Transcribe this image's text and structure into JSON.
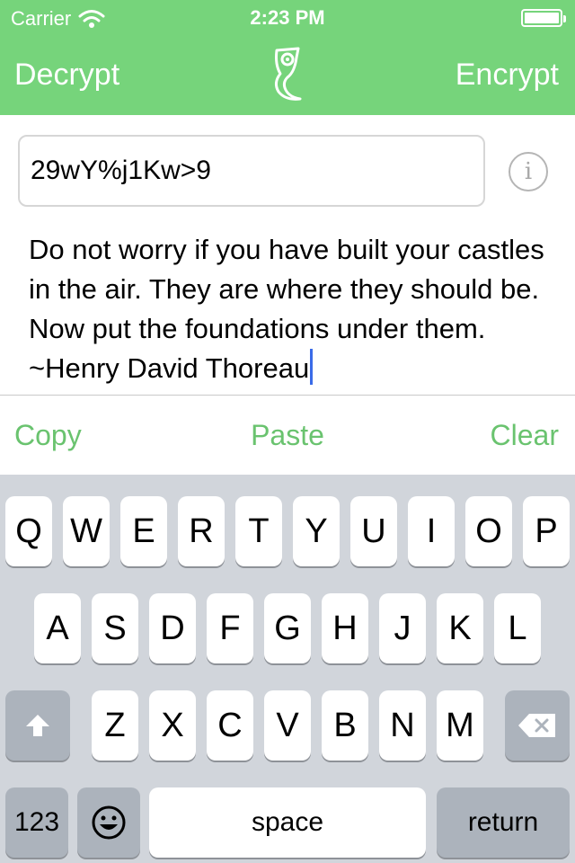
{
  "status_bar": {
    "carrier": "Carrier",
    "time": "2:23 PM"
  },
  "nav": {
    "left_label": "Decrypt",
    "right_label": "Encrypt",
    "logo_icon": "bird-logo-icon"
  },
  "key_field": {
    "value": "29wY%j1Kw>9"
  },
  "info_button": {
    "glyph": "i"
  },
  "message": {
    "text": "Do not worry if you have built your castles in the air. They are where they should be. Now put the foundations under them. ~Henry David Thoreau"
  },
  "actions": {
    "copy": "Copy",
    "paste": "Paste",
    "clear": "Clear"
  },
  "keyboard": {
    "row1": [
      "Q",
      "W",
      "E",
      "R",
      "T",
      "Y",
      "U",
      "I",
      "O",
      "P"
    ],
    "row2": [
      "A",
      "S",
      "D",
      "F",
      "G",
      "H",
      "J",
      "K",
      "L"
    ],
    "row3": [
      "Z",
      "X",
      "C",
      "V",
      "B",
      "N",
      "M"
    ],
    "numbers": "123",
    "space": "space",
    "return": "return"
  },
  "colors": {
    "accent": "#76d47b",
    "action_text": "#6ac36f",
    "keyboard_bg": "#d1d5db",
    "cursor": "#3a6be8"
  }
}
